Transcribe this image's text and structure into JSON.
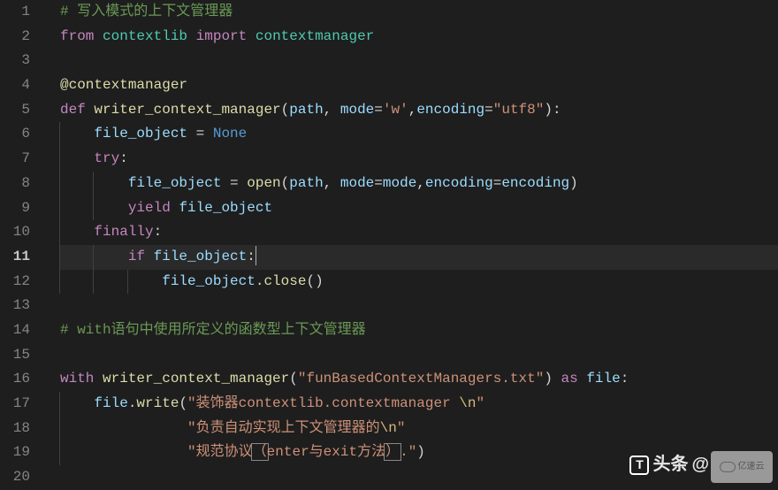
{
  "editor": {
    "current_line": 11,
    "total_lines": 20,
    "lines": [
      {
        "n": 1,
        "indent": 0,
        "tokens": [
          [
            "comment",
            "# 写入模式的上下文管理器"
          ]
        ]
      },
      {
        "n": 2,
        "indent": 0,
        "tokens": [
          [
            "keyword",
            "from"
          ],
          [
            "default",
            " "
          ],
          [
            "module",
            "contextlib"
          ],
          [
            "default",
            " "
          ],
          [
            "keyword",
            "import"
          ],
          [
            "default",
            " "
          ],
          [
            "module",
            "contextmanager"
          ]
        ]
      },
      {
        "n": 3,
        "indent": 0,
        "tokens": []
      },
      {
        "n": 4,
        "indent": 0,
        "tokens": [
          [
            "decor",
            "@contextmanager"
          ]
        ]
      },
      {
        "n": 5,
        "indent": 0,
        "tokens": [
          [
            "keyword",
            "def"
          ],
          [
            "default",
            " "
          ],
          [
            "func",
            "writer_context_manager"
          ],
          [
            "punct",
            "("
          ],
          [
            "param",
            "path"
          ],
          [
            "punct",
            ", "
          ],
          [
            "param",
            "mode"
          ],
          [
            "punct",
            "="
          ],
          [
            "string",
            "'w'"
          ],
          [
            "punct",
            ","
          ],
          [
            "param",
            "encoding"
          ],
          [
            "punct",
            "="
          ],
          [
            "string",
            "\"utf8\""
          ],
          [
            "punct",
            "):"
          ]
        ]
      },
      {
        "n": 6,
        "indent": 1,
        "tokens": [
          [
            "param",
            "file_object"
          ],
          [
            "default",
            " = "
          ],
          [
            "const",
            "None"
          ]
        ]
      },
      {
        "n": 7,
        "indent": 1,
        "tokens": [
          [
            "keyword",
            "try"
          ],
          [
            "punct",
            ":"
          ]
        ]
      },
      {
        "n": 8,
        "indent": 2,
        "tokens": [
          [
            "param",
            "file_object"
          ],
          [
            "default",
            " = "
          ],
          [
            "func",
            "open"
          ],
          [
            "punct",
            "("
          ],
          [
            "param",
            "path"
          ],
          [
            "punct",
            ", "
          ],
          [
            "param",
            "mode"
          ],
          [
            "punct",
            "="
          ],
          [
            "param",
            "mode"
          ],
          [
            "punct",
            ","
          ],
          [
            "param",
            "encoding"
          ],
          [
            "punct",
            "="
          ],
          [
            "param",
            "encoding"
          ],
          [
            "punct",
            ")"
          ]
        ]
      },
      {
        "n": 9,
        "indent": 2,
        "tokens": [
          [
            "keyword",
            "yield"
          ],
          [
            "default",
            " "
          ],
          [
            "param",
            "file_object"
          ]
        ]
      },
      {
        "n": 10,
        "indent": 1,
        "tokens": [
          [
            "keyword",
            "finally"
          ],
          [
            "punct",
            ":"
          ]
        ]
      },
      {
        "n": 11,
        "indent": 2,
        "tokens": [
          [
            "keyword",
            "if"
          ],
          [
            "default",
            " "
          ],
          [
            "param",
            "file_object"
          ],
          [
            "punct",
            ":"
          ]
        ],
        "cursor_after": true
      },
      {
        "n": 12,
        "indent": 3,
        "tokens": [
          [
            "param",
            "file_object"
          ],
          [
            "punct",
            "."
          ],
          [
            "func",
            "close"
          ],
          [
            "punct",
            "()"
          ]
        ]
      },
      {
        "n": 13,
        "indent": 0,
        "tokens": []
      },
      {
        "n": 14,
        "indent": 0,
        "tokens": [
          [
            "comment",
            "# with语句中使用所定义的函数型上下文管理器"
          ]
        ]
      },
      {
        "n": 15,
        "indent": 0,
        "tokens": []
      },
      {
        "n": 16,
        "indent": 0,
        "tokens": [
          [
            "keyword",
            "with"
          ],
          [
            "default",
            " "
          ],
          [
            "func",
            "writer_context_manager"
          ],
          [
            "punct",
            "("
          ],
          [
            "string",
            "\"funBasedContextManagers.txt\""
          ],
          [
            "punct",
            ") "
          ],
          [
            "keyword",
            "as"
          ],
          [
            "default",
            " "
          ],
          [
            "param",
            "file"
          ],
          [
            "punct",
            ":"
          ]
        ]
      },
      {
        "n": 17,
        "indent": 1,
        "tokens": [
          [
            "param",
            "file"
          ],
          [
            "punct",
            "."
          ],
          [
            "func",
            "write"
          ],
          [
            "punct",
            "("
          ],
          [
            "string",
            "\"装饰器contextlib.contextmanager "
          ],
          [
            "escape",
            "\\n"
          ],
          [
            "string",
            "\""
          ]
        ]
      },
      {
        "n": 18,
        "indent": 1,
        "string_continuation": true,
        "tokens": [
          [
            "string",
            "\"负责自动实现上下文管理器的"
          ],
          [
            "escape",
            "\\n"
          ],
          [
            "string",
            "\""
          ]
        ]
      },
      {
        "n": 19,
        "indent": 1,
        "string_continuation": true,
        "tokens": [
          [
            "string",
            "\"规范协议"
          ],
          [
            "bracket",
            "（"
          ],
          [
            "string",
            "enter与exit方法"
          ],
          [
            "bracket",
            "）"
          ],
          [
            "string",
            ".\""
          ],
          [
            "punct",
            ")"
          ]
        ]
      },
      {
        "n": 20,
        "indent": 0,
        "tokens": []
      }
    ]
  },
  "watermarks": {
    "toutiao_prefix": "头条",
    "toutiao_at": "@",
    "yisu": "亿速云"
  },
  "colors": {
    "background": "#1e1e1e",
    "current_line_bg": "#2a2a2a",
    "gutter": "#858585",
    "comment": "#6a9955",
    "keyword": "#c586c0",
    "module": "#4ec9b0",
    "func": "#dcdcaa",
    "param": "#9cdcfe",
    "string": "#ce9178",
    "const": "#569cd6",
    "escape": "#d7ba7d",
    "default": "#d4d4d4"
  }
}
